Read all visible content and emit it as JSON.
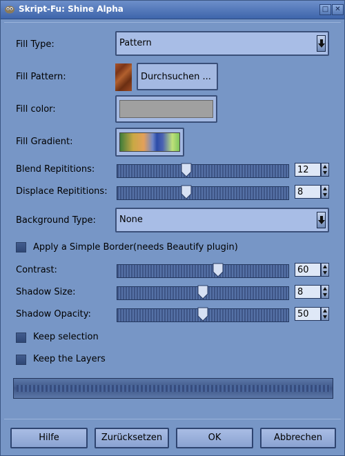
{
  "window": {
    "title": "Skript-Fu: Shine Alpha"
  },
  "fields": {
    "fill_type": {
      "label": "Fill Type:",
      "value": "Pattern"
    },
    "fill_pattern": {
      "label": "Fill Pattern:",
      "browse_label": "Durchsuchen ..."
    },
    "fill_color": {
      "label": "Fill color:",
      "color": "#a0a0a0"
    },
    "fill_gradient": {
      "label": "Fill Gradient:"
    },
    "blend_repititions": {
      "label": "Blend Repititions:",
      "value": "12"
    },
    "displace_repititions": {
      "label": "Displace Repititions:",
      "value": "8"
    },
    "background_type": {
      "label": "Background Type:",
      "value": "None"
    },
    "simple_border": {
      "label": "Apply a Simple Border(needs Beautify plugin)",
      "checked": false
    },
    "contrast": {
      "label": "Contrast:",
      "value": "60"
    },
    "shadow_size": {
      "label": "Shadow Size:",
      "value": "8"
    },
    "shadow_opacity": {
      "label": "Shadow Opacity:",
      "value": "50"
    },
    "keep_selection": {
      "label": "Keep selection",
      "checked": false
    },
    "keep_layers": {
      "label": "Keep the Layers",
      "checked": false
    }
  },
  "buttons": {
    "help": "Hilfe",
    "reset": "Zurücksetzen",
    "ok": "OK",
    "cancel": "Abbrechen"
  },
  "colors": {
    "window_bg": "#7796c6",
    "titlebar": "#3e65ab"
  }
}
